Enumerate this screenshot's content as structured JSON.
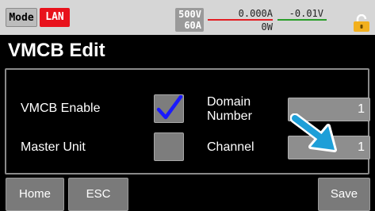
{
  "status_bar": {
    "mode_label": "Mode",
    "lan_label": "LAN",
    "voltage_range": "500V",
    "current_range": "60A",
    "current_reading": "0.000A",
    "voltage_reading": "-0.01V",
    "power_reading": "0W",
    "lock_icon": "lock-icon"
  },
  "page": {
    "title": "VMCB Edit"
  },
  "fields": {
    "vmcb_enable": {
      "label": "VMCB Enable",
      "checked": true
    },
    "master_unit": {
      "label": "Master Unit",
      "checked": false
    },
    "domain_number": {
      "label_line1": "Domain",
      "label_line2": "Number",
      "value": "1"
    },
    "channel": {
      "label": "Channel",
      "value": "1"
    }
  },
  "soft_keys": {
    "home": "Home",
    "esc": "ESC",
    "save": "Save"
  },
  "colors": {
    "lan_badge": "#e8111b",
    "checkmark": "#1a1aff",
    "pointer_arrow": "#1e9fd8",
    "current_underline": "#e21e24",
    "voltage_underline": "#2a9e2a",
    "lock": "#f2b01e"
  }
}
